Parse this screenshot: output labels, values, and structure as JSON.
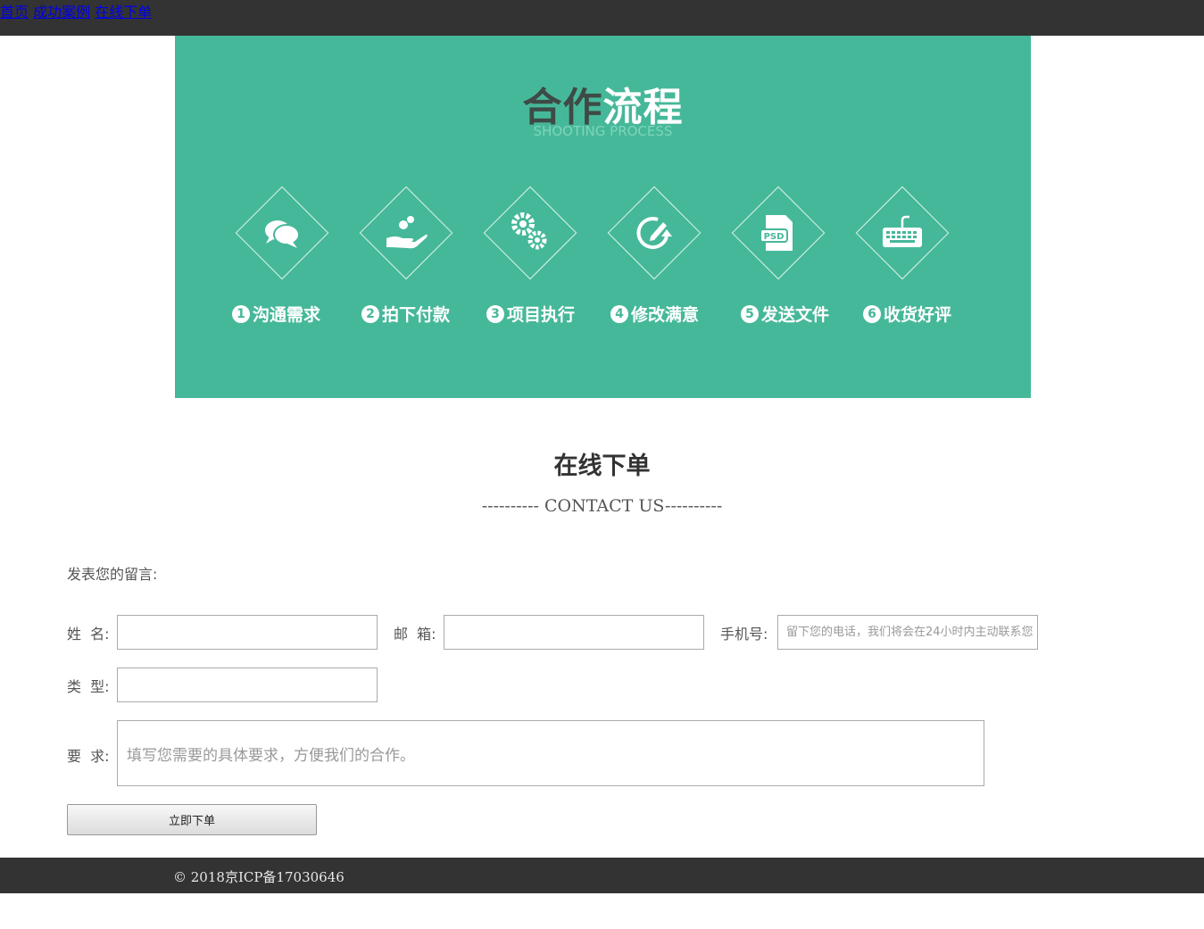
{
  "nav": {
    "items": [
      {
        "label": "首页"
      },
      {
        "label": "成功案例"
      },
      {
        "label": "在线下单"
      }
    ]
  },
  "banner": {
    "title_part1": "合作",
    "title_part2": "流程",
    "subtitle": "SHOOTING PROCESS",
    "steps": [
      {
        "num": "1",
        "label": "沟通需求",
        "icon": "chat-bubbles-icon"
      },
      {
        "num": "2",
        "label": "拍下付款",
        "icon": "hand-coins-icon"
      },
      {
        "num": "3",
        "label": "项目执行",
        "icon": "gears-icon"
      },
      {
        "num": "4",
        "label": "修改满意",
        "icon": "edit-refresh-icon"
      },
      {
        "num": "5",
        "label": "发送文件",
        "icon": "psd-file-icon"
      },
      {
        "num": "6",
        "label": "收货好评",
        "icon": "keyboard-icon"
      }
    ]
  },
  "section": {
    "title": "在线下单",
    "subtitle": "---------- CONTACT US----------"
  },
  "form": {
    "intro": "发表您的留言:",
    "name_label": "姓  名:",
    "name_value": "",
    "email_label": "邮  箱:",
    "email_value": "",
    "phone_label": "手机号:",
    "phone_placeholder": "留下您的电话，我们将会在24小时内主动联系您",
    "type_label": "类  型:",
    "type_value": "",
    "req_label": "要  求:",
    "req_placeholder": "填写您需要的具体要求，方便我们的合作。",
    "submit_label": "立即下单"
  },
  "footer": {
    "text": "© 2018京ICP备17030646"
  }
}
